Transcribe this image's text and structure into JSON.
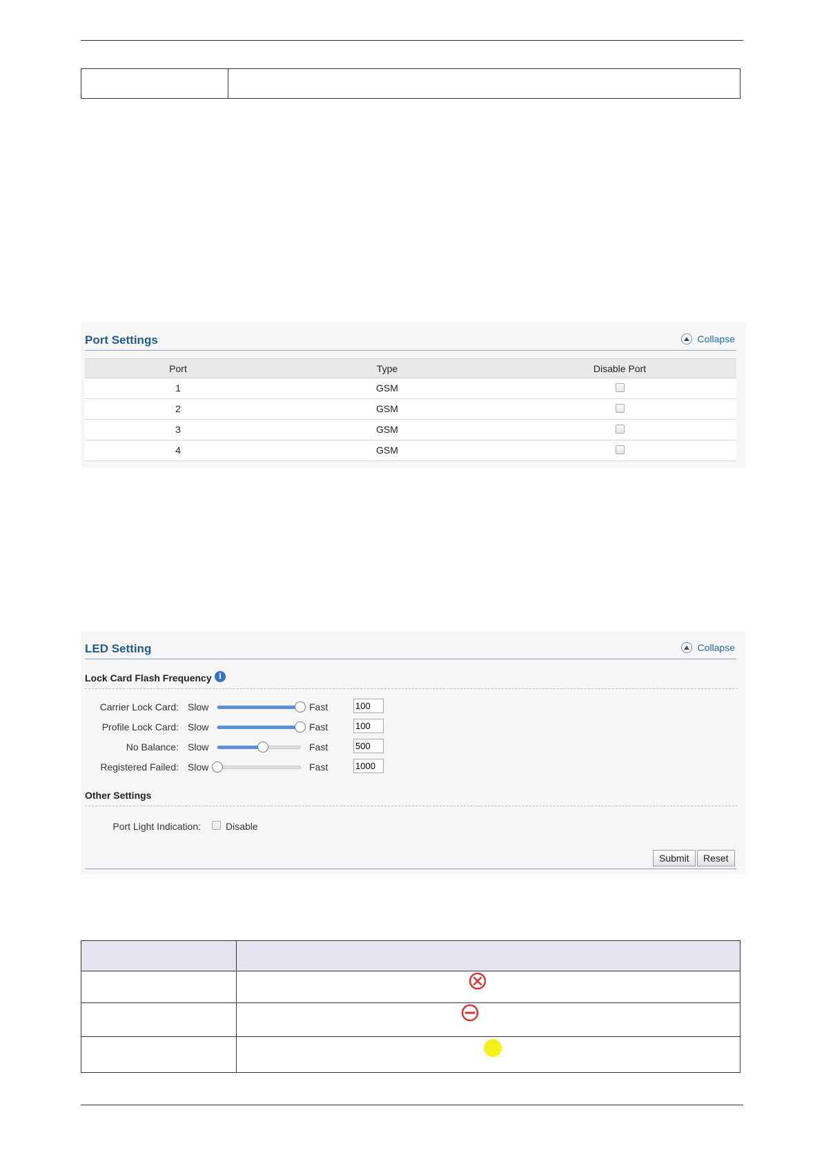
{
  "port_settings": {
    "title": "Port Settings",
    "collapse_label": "Collapse",
    "columns": [
      "Port",
      "Type",
      "Disable Port"
    ],
    "rows": [
      {
        "port": "1",
        "type": "GSM",
        "disabled": false
      },
      {
        "port": "2",
        "type": "GSM",
        "disabled": false
      },
      {
        "port": "3",
        "type": "GSM",
        "disabled": false
      },
      {
        "port": "4",
        "type": "GSM",
        "disabled": false
      }
    ]
  },
  "led_setting": {
    "title": "LED Setting",
    "collapse_label": "Collapse",
    "flash_section_title": "Lock Card Flash Frequency",
    "slow_label": "Slow",
    "fast_label": "Fast",
    "sliders": [
      {
        "label": "Carrier Lock Card:",
        "value": "100",
        "level": 1.0
      },
      {
        "label": "Profile Lock Card:",
        "value": "100",
        "level": 1.0
      },
      {
        "label": "No Balance:",
        "value": "500",
        "level": 0.55
      },
      {
        "label": "Registered Failed:",
        "value": "1000",
        "level": 0.0
      }
    ],
    "other_section_title": "Other Settings",
    "port_light_label": "Port Light Indication:",
    "disable_label": "Disable",
    "submit_label": "Submit",
    "reset_label": "Reset",
    "accent_color": "#1f5b8c",
    "slider_fill_color": "#5b8ed8"
  },
  "status_table": {
    "header_bg": "#e6e4f0",
    "icons": [
      "red-x-circle-icon",
      "red-minus-circle-icon",
      "yellow-dot-icon"
    ]
  }
}
